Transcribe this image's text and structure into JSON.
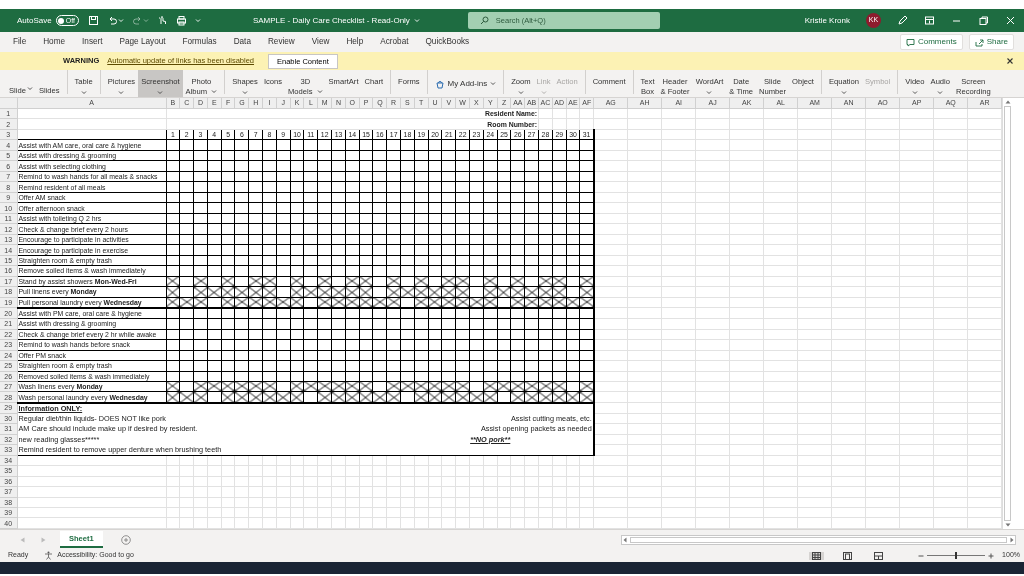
{
  "title_bar": {
    "autosave_label": "AutoSave",
    "autosave": {
      "label": "Off",
      "on": false
    },
    "title": "SAMPLE - Daily Care Checklist - Read-Only",
    "search": {
      "placeholder": "Search (Alt+Q)"
    },
    "user": "Kristie Kronk",
    "initials": "KK"
  },
  "menu": {
    "tabs": [
      {
        "label": "File",
        "selected": false
      },
      {
        "label": "Home",
        "selected": false
      },
      {
        "label": "Insert",
        "selected": false
      },
      {
        "label": "Page Layout",
        "selected": false
      },
      {
        "label": "Formulas",
        "selected": false
      },
      {
        "label": "Data",
        "selected": false
      },
      {
        "label": "Review",
        "selected": false
      },
      {
        "label": "View",
        "selected": false
      },
      {
        "label": "Help",
        "selected": false
      },
      {
        "label": "Acrobat",
        "selected": false
      },
      {
        "label": "QuickBooks",
        "selected": false
      }
    ],
    "buttons": [
      "Comments",
      "Share"
    ]
  },
  "message_bar": {
    "title": "WARNING",
    "message": "Automatic update of links has been disabled",
    "button": "Enable Content"
  },
  "ribbon": {
    "groups": [
      [
        {
          "lines": [
            "Slide"
          ],
          "kind": "cut",
          "caret": true,
          "selected": false,
          "disabled": false
        },
        {
          "lines": [
            "Slides"
          ],
          "kind": "cut",
          "caret": false,
          "selected": false,
          "disabled": false
        }
      ],
      [
        {
          "lines": [
            "Table"
          ],
          "kind": "stacked",
          "caret": true,
          "selected": false,
          "disabled": false
        }
      ],
      [
        {
          "lines": [
            "Pictures"
          ],
          "kind": "stacked",
          "caret": true,
          "selected": false,
          "disabled": false
        },
        {
          "lines": [
            "Screenshot"
          ],
          "kind": "stacked",
          "caret": true,
          "selected": true,
          "disabled": false
        },
        {
          "lines": [
            "Photo",
            "Album"
          ],
          "kind": "stacked",
          "caret": true,
          "selected": false,
          "disabled": false
        }
      ],
      [
        {
          "lines": [
            "Shapes"
          ],
          "kind": "stacked",
          "caret": true,
          "selected": false,
          "disabled": false
        },
        {
          "lines": [
            "Icons"
          ],
          "kind": "stacked",
          "caret": false,
          "selected": false,
          "disabled": false
        },
        {
          "lines": [
            "3D",
            "Models"
          ],
          "kind": "stacked",
          "caret": true,
          "selected": false,
          "disabled": false
        },
        {
          "lines": [
            "SmartArt"
          ],
          "kind": "stacked",
          "caret": false,
          "selected": false,
          "disabled": false
        },
        {
          "lines": [
            "Chart"
          ],
          "kind": "stacked",
          "caret": false,
          "selected": false,
          "disabled": false
        }
      ],
      [
        {
          "lines": [
            "Forms"
          ],
          "kind": "stacked",
          "caret": false,
          "selected": false,
          "disabled": false
        }
      ],
      [
        {
          "lines": [
            "My Add-ins"
          ],
          "kind": "inline",
          "caret": true,
          "selected": false,
          "disabled": false
        }
      ],
      [
        {
          "lines": [
            "Zoom"
          ],
          "kind": "stacked",
          "caret": true,
          "selected": false,
          "disabled": false
        },
        {
          "lines": [
            "Link"
          ],
          "kind": "stacked",
          "caret": true,
          "selected": false,
          "disabled": true
        },
        {
          "lines": [
            "Action"
          ],
          "kind": "stacked",
          "caret": false,
          "selected": false,
          "disabled": true
        }
      ],
      [
        {
          "lines": [
            "Comment"
          ],
          "kind": "stacked",
          "caret": false,
          "selected": false,
          "disabled": false
        }
      ],
      [
        {
          "lines": [
            "Text",
            "Box"
          ],
          "kind": "stacked",
          "caret": false,
          "selected": false,
          "disabled": false
        },
        {
          "lines": [
            "Header",
            "& Footer"
          ],
          "kind": "stacked",
          "caret": false,
          "selected": false,
          "disabled": false
        },
        {
          "lines": [
            "WordArt"
          ],
          "kind": "stacked",
          "caret": true,
          "selected": false,
          "disabled": false
        },
        {
          "lines": [
            "Date",
            "& Time"
          ],
          "kind": "stacked",
          "caret": false,
          "selected": false,
          "disabled": false
        },
        {
          "lines": [
            "Slide",
            "Number"
          ],
          "kind": "stacked",
          "caret": false,
          "selected": false,
          "disabled": false
        },
        {
          "lines": [
            "Object"
          ],
          "kind": "stacked",
          "caret": false,
          "selected": false,
          "disabled": false
        }
      ],
      [
        {
          "lines": [
            "Equation"
          ],
          "kind": "stacked",
          "caret": true,
          "selected": false,
          "disabled": false
        },
        {
          "lines": [
            "Symbol"
          ],
          "kind": "stacked",
          "caret": false,
          "selected": false,
          "disabled": true
        }
      ],
      [
        {
          "lines": [
            "Video"
          ],
          "kind": "stacked",
          "caret": true,
          "selected": false,
          "disabled": false
        },
        {
          "lines": [
            "Audio"
          ],
          "kind": "stacked",
          "caret": true,
          "selected": false,
          "disabled": false
        },
        {
          "lines": [
            "Screen",
            "Recording"
          ],
          "kind": "stacked",
          "caret": false,
          "selected": false,
          "disabled": false
        }
      ]
    ]
  },
  "sheet": {
    "columns": [
      "A",
      "B",
      "C",
      "D",
      "E",
      "F",
      "G",
      "H",
      "I",
      "J",
      "K",
      "L",
      "M",
      "N",
      "O",
      "P",
      "Q",
      "R",
      "S",
      "T",
      "U",
      "V",
      "W",
      "X",
      "Y",
      "Z",
      "AA",
      "AB",
      "AC",
      "AD",
      "AE",
      "AF",
      "AG",
      "AH",
      "AI",
      "AJ",
      "AK",
      "AL",
      "AM",
      "AN",
      "AO",
      "AP",
      "AQ",
      "AR"
    ],
    "row_numbers": [
      "1",
      "2",
      "3",
      "4",
      "5",
      "6",
      "7",
      "8",
      "9",
      "10",
      "11",
      "12",
      "13",
      "14",
      "15",
      "16",
      "17",
      "18",
      "19",
      "20",
      "21",
      "22",
      "23",
      "24",
      "25",
      "26",
      "27",
      "28",
      "29",
      "30",
      "31",
      "32",
      "33",
      "34",
      "35",
      "36",
      "37",
      "38",
      "39",
      "40"
    ],
    "header_fields": [
      "Resident Name:",
      "Room Number:"
    ],
    "days": [
      "1",
      "2",
      "3",
      "4",
      "5",
      "6",
      "7",
      "8",
      "9",
      "10",
      "11",
      "12",
      "13",
      "14",
      "15",
      "16",
      "17",
      "18",
      "19",
      "20",
      "21",
      "22",
      "23",
      "24",
      "25",
      "26",
      "27",
      "28",
      "29",
      "30",
      "31"
    ],
    "sections": [
      {
        "tasks": [
          {
            "text": "Assist with AM care, oral care & hygiene"
          },
          {
            "text": "Assist with dressing & grooming"
          },
          {
            "text": "Assist with selecting clothing"
          },
          {
            "text": "Remind to wash hands for all meals & snacks"
          },
          {
            "text": "Remind resident of all meals"
          },
          {
            "text": "Offer AM snack"
          },
          {
            "text": "Offer afternoon snack"
          },
          {
            "text": "Assist with toileting Q 2 hrs"
          },
          {
            "text": "Check & change brief every 2 hours"
          },
          {
            "text": "Encourage to participate in activities"
          },
          {
            "text": "Encourage to participate in exercise"
          },
          {
            "text": "Straighten room & empty trash"
          },
          {
            "text": "Remove soiled items & wash immediately"
          },
          {
            "text": "Stand by assist showers **Mon-Wed-Fri**",
            "crossed": [
              true,
              false,
              true,
              false,
              true,
              false,
              true,
              true,
              false,
              true,
              false,
              true,
              false,
              true,
              true,
              false,
              true,
              false,
              true,
              false,
              true,
              true,
              false,
              true,
              false,
              true,
              false,
              true,
              true,
              false,
              true
            ]
          },
          {
            "text": "Pull linens every **Monday**",
            "crossed": [
              true,
              false,
              true,
              true,
              true,
              true,
              true,
              true,
              false,
              true,
              true,
              true,
              true,
              true,
              true,
              false,
              true,
              true,
              true,
              true,
              true,
              true,
              false,
              true,
              true,
              true,
              true,
              true,
              true,
              false,
              true
            ]
          },
          {
            "text": "Pull personal laundry every **Wednesday**",
            "crossed": [
              true,
              true,
              true,
              false,
              true,
              true,
              true,
              true,
              true,
              true,
              false,
              true,
              true,
              true,
              true,
              true,
              true,
              false,
              true,
              true,
              true,
              true,
              true,
              true,
              false,
              true,
              true,
              true,
              true,
              true,
              true
            ]
          }
        ]
      },
      {
        "tasks": [
          {
            "text": "Assist with PM care, oral care & hygiene"
          },
          {
            "text": "Assist with dressing & grooming"
          },
          {
            "text": "Check & change brief every 2 hr while awake"
          },
          {
            "text": "Remind to wash hands before snack"
          },
          {
            "text": "Offer PM snack"
          },
          {
            "text": "Straighten room & empty trash"
          },
          {
            "text": "Removed soiled items & wash immediately"
          },
          {
            "text": "Wash linens every **Monday**",
            "crossed": [
              true,
              false,
              true,
              true,
              true,
              true,
              true,
              true,
              false,
              true,
              true,
              true,
              true,
              true,
              true,
              false,
              true,
              true,
              true,
              true,
              true,
              true,
              false,
              true,
              true,
              true,
              true,
              true,
              true,
              false,
              true
            ]
          },
          {
            "text": "Wash personal laundry every **Wednesday**",
            "crossed": [
              true,
              true,
              true,
              false,
              true,
              true,
              true,
              true,
              true,
              true,
              false,
              true,
              true,
              true,
              true,
              true,
              true,
              false,
              true,
              true,
              true,
              true,
              true,
              true,
              false,
              true,
              true,
              true,
              true,
              true,
              true
            ]
          }
        ]
      }
    ],
    "info_title": "Information ONLY:",
    "info_rows": [
      {
        "left": "Regular diet/thin liquids- DOES NOT like pork",
        "right": "Assist cutting meats, etc."
      },
      {
        "left": "AM Care should include make up if desired by resident.",
        "right": "Assist opening packets as needed"
      },
      {
        "left": "new reading glasses*****",
        "note": "**NO pork**"
      },
      {
        "left": "Remind resident to remove upper denture when brushing teeth"
      }
    ]
  },
  "sheet_tabs": [
    {
      "label": "Sheet1",
      "selected": true
    }
  ],
  "status_bar": {
    "ready": "Ready",
    "accessibility": "Accessibility: Good to go",
    "views": [
      {
        "selected": true
      },
      {
        "selected": false
      },
      {
        "selected": false
      }
    ],
    "zoom": {
      "level": 0.5,
      "reading": "100%"
    }
  }
}
